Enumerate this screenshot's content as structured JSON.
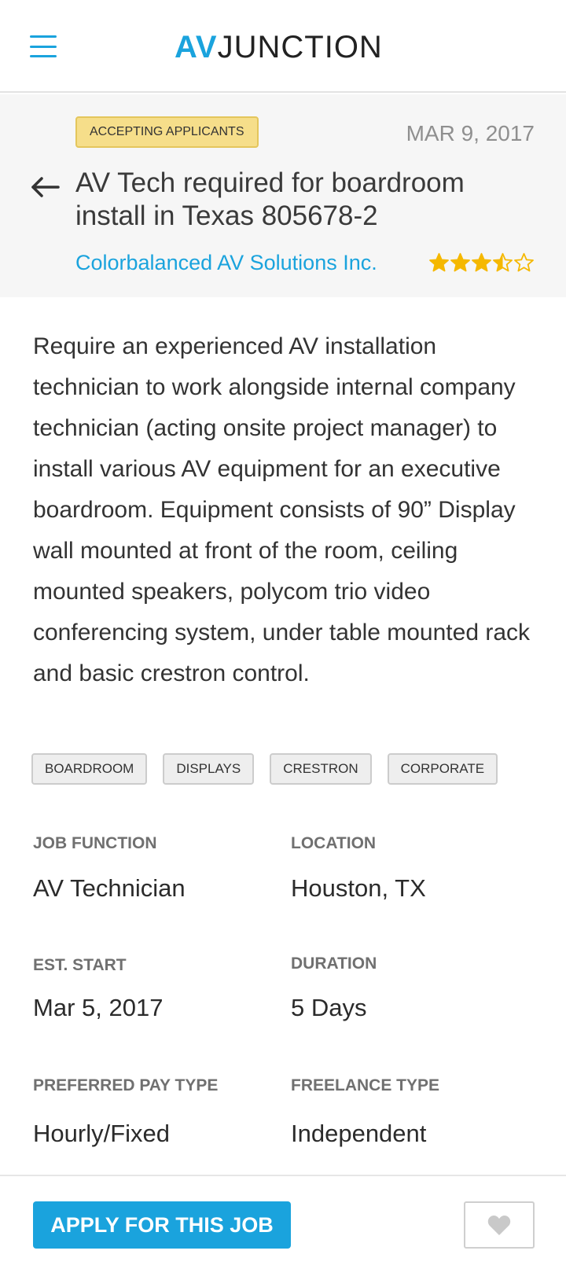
{
  "header": {
    "menu_icon": "hamburger-menu-icon",
    "logo_av": "AV",
    "logo_junction": "JUNCTION",
    "brand_color": "#1aa3dd"
  },
  "job": {
    "status": "ACCEPTING APPLICANTS",
    "date": "MAR 9, 2017",
    "back_icon": "arrow-left-icon",
    "title": "AV Tech required for boardroom install in Texas 805678-2",
    "company": "Colorbalanced AV Solutions Inc.",
    "rating": 3.5,
    "rating_max": 5,
    "description": "Require an experienced AV installation technician to work alongside internal company technician (acting onsite project manager) to install various AV equipment for an executive boardroom.  Equipment consists of 90” Display wall mounted at front of the room, ceiling mounted speakers, polycom trio video conferencing system, under table mounted rack and basic crestron control.",
    "tags": [
      "BOARDROOM",
      "DISPLAYS",
      "CRESTRON",
      "CORPORATE"
    ]
  },
  "details": {
    "job_function": {
      "label": "JOB FUNCTION",
      "value": "AV Technician"
    },
    "location": {
      "label": "LOCATION",
      "value": "Houston, TX"
    },
    "est_start": {
      "label": "EST. START",
      "value": "Mar 5, 2017"
    },
    "duration": {
      "label": "DURATION",
      "value": "5 Days"
    },
    "pay_type": {
      "label": "PREFERRED PAY TYPE",
      "value": "Hourly/Fixed"
    },
    "freelance_type": {
      "label": "FREELANCE TYPE",
      "value": "Independent"
    }
  },
  "footer": {
    "apply_label": "APPLY FOR THIS JOB",
    "favorite_icon": "heart-icon"
  },
  "colors": {
    "accent": "#1aa3dd",
    "badge_bg": "#f6de8a",
    "star": "#f5b800"
  }
}
